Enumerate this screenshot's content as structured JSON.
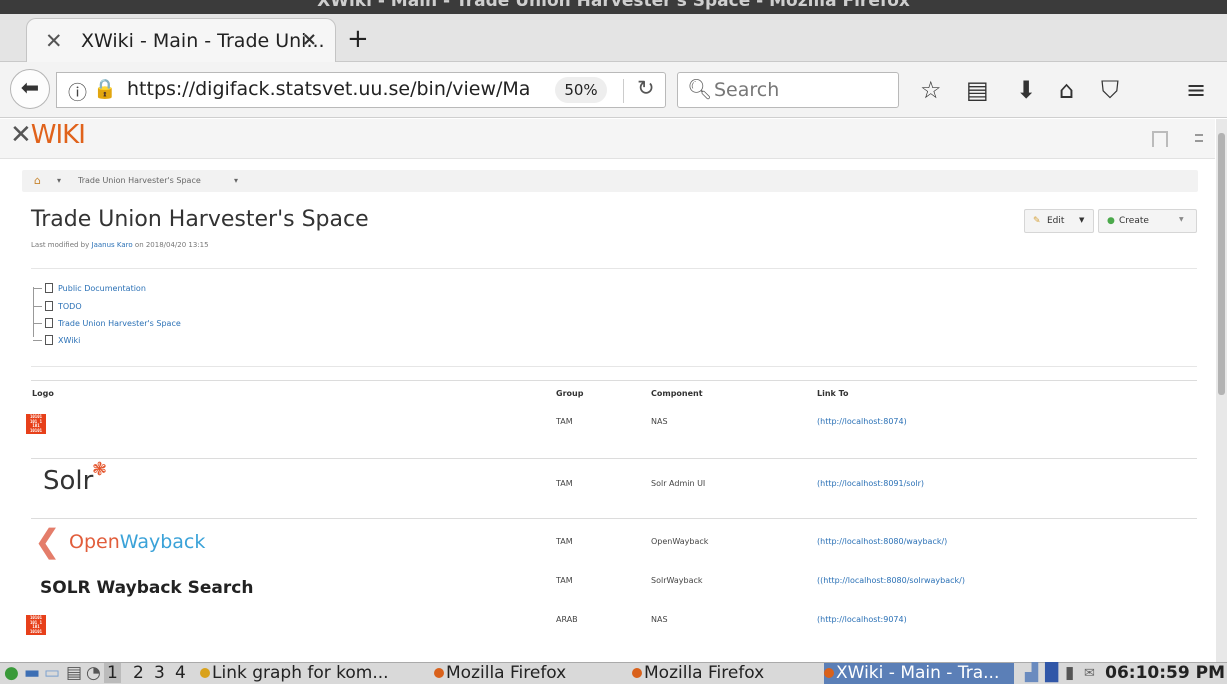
{
  "os": {
    "window_title": "XWiki - Main - Trade Union Harvester's Space - Mozilla Firefox"
  },
  "browser": {
    "tab_title": "XWiki - Main - Trade Uni...",
    "tab_close": "×",
    "new_tab": "+",
    "url": "https://digifack.statsvet.uu.se/bin/view/Main/#",
    "zoom": "50%",
    "search_placeholder": "Search"
  },
  "xwiki": {
    "logo_x": "✕",
    "logo_text": "WIKI"
  },
  "breadcrumb": {
    "home_caret": "▾",
    "item": "Trade Union Harvester's Space",
    "item_caret": "▾"
  },
  "page": {
    "title": "Trade Union Harvester's Space",
    "modified_prefix": "Last modified by",
    "modified_user": "Jaanus Karo",
    "modified_suffix": "on 2018/04/20 13:15",
    "edit_label": "Edit",
    "create_label": "Create"
  },
  "tree": [
    {
      "label": "Public Documentation"
    },
    {
      "label": "TODO"
    },
    {
      "label": "Trade Union Harvester's Space"
    },
    {
      "label": "XWiki"
    }
  ],
  "table": {
    "headers": {
      "logo": "Logo",
      "group": "Group",
      "component": "Component",
      "link": "Link To"
    },
    "rows": [
      {
        "logo": "NAS",
        "group": "TAM",
        "component": "NAS",
        "link": "(http://localhost:8074)"
      },
      {
        "logo": "Solr",
        "group": "TAM",
        "component": "Solr Admin UI",
        "link": "(http://localhost:8091/solr)"
      },
      {
        "logo": "OpenWayback",
        "group": "TAM",
        "component": "OpenWayback",
        "link": "(http://localhost:8080/wayback/)"
      },
      {
        "logo": "SOLR Wayback Search",
        "group": "TAM",
        "component": "SolrWayback",
        "link": "((http://localhost:8080/solrwayback/)"
      },
      {
        "logo": "NAS",
        "group": "ARAB",
        "component": "NAS",
        "link": "(http://localhost:9074)"
      }
    ],
    "logo_texts": {
      "solr": "Solr",
      "ow_open": "Open",
      "ow_wayback": "Wayback",
      "solrwayback": "SOLR Wayback Search",
      "nas_bits": "10101 101 1 101 10101"
    }
  },
  "taskbar": {
    "workspaces": [
      "1",
      "2",
      "3",
      "4"
    ],
    "tasks": [
      "Link graph for kom...",
      "Mozilla Firefox",
      "Mozilla Firefox",
      "XWiki - Main - Tra..."
    ],
    "clock": "06:10:59 PM"
  }
}
